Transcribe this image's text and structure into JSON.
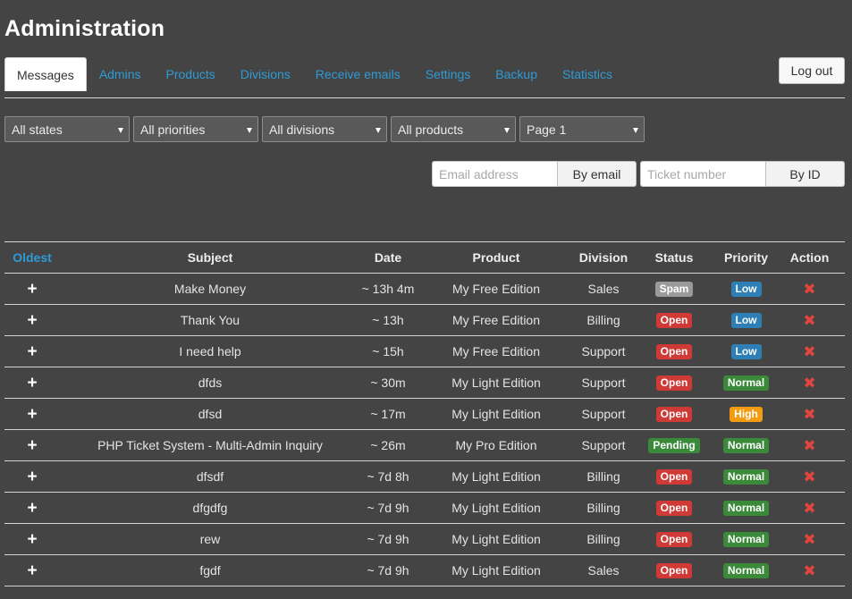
{
  "title": "Administration",
  "nav": {
    "tabs": [
      {
        "label": "Messages",
        "active": true
      },
      {
        "label": "Admins"
      },
      {
        "label": "Products"
      },
      {
        "label": "Divisions"
      },
      {
        "label": "Receive emails"
      },
      {
        "label": "Settings"
      },
      {
        "label": "Backup"
      },
      {
        "label": "Statistics"
      }
    ],
    "logout_label": "Log out"
  },
  "filters": {
    "states": "All states",
    "priorities": "All priorities",
    "divisions": "All divisions",
    "products": "All products",
    "page": "Page 1"
  },
  "search": {
    "email_placeholder": "Email address",
    "email_button": "By email",
    "ticket_placeholder": "Ticket number",
    "ticket_button": "By ID"
  },
  "table": {
    "headers": {
      "sort": "Oldest",
      "subject": "Subject",
      "date": "Date",
      "product": "Product",
      "division": "Division",
      "status": "Status",
      "priority": "Priority",
      "action": "Action"
    },
    "expand_symbol": "+",
    "delete_symbol": "✖",
    "rows": [
      {
        "subject": "Make Money",
        "date": "~ 13h 4m",
        "product": "My Free Edition",
        "division": "Sales",
        "status": "Spam",
        "priority": "Low"
      },
      {
        "subject": "Thank You",
        "date": "~ 13h",
        "product": "My Free Edition",
        "division": "Billing",
        "status": "Open",
        "priority": "Low"
      },
      {
        "subject": "I need help",
        "date": "~ 15h",
        "product": "My Free Edition",
        "division": "Support",
        "status": "Open",
        "priority": "Low"
      },
      {
        "subject": "dfds",
        "date": "~ 30m",
        "product": "My Light Edition",
        "division": "Support",
        "status": "Open",
        "priority": "Normal"
      },
      {
        "subject": "dfsd",
        "date": "~ 17m",
        "product": "My Light Edition",
        "division": "Support",
        "status": "Open",
        "priority": "High"
      },
      {
        "subject": "PHP Ticket System - Multi-Admin Inquiry",
        "date": "~ 26m",
        "product": "My Pro Edition",
        "division": "Support",
        "status": "Pending",
        "priority": "Normal"
      },
      {
        "subject": "dfsdf",
        "date": "~ 7d 8h",
        "product": "My Light Edition",
        "division": "Billing",
        "status": "Open",
        "priority": "Normal"
      },
      {
        "subject": "dfgdfg",
        "date": "~ 7d 9h",
        "product": "My Light Edition",
        "division": "Billing",
        "status": "Open",
        "priority": "Normal"
      },
      {
        "subject": "rew",
        "date": "~ 7d 9h",
        "product": "My Light Edition",
        "division": "Billing",
        "status": "Open",
        "priority": "Normal"
      },
      {
        "subject": "fgdf",
        "date": "~ 7d 9h",
        "product": "My Light Edition",
        "division": "Sales",
        "status": "Open",
        "priority": "Normal"
      }
    ]
  },
  "colors": {
    "background": "#444444",
    "link": "#2e9bd6",
    "status": {
      "Spam": "#9a9a9a",
      "Open": "#cf3a36",
      "Pending": "#3a8a3a"
    },
    "priority": {
      "Low": "#2e7fb5",
      "Normal": "#3a8a3a",
      "High": "#f39c12"
    },
    "delete": "#e0463f"
  }
}
